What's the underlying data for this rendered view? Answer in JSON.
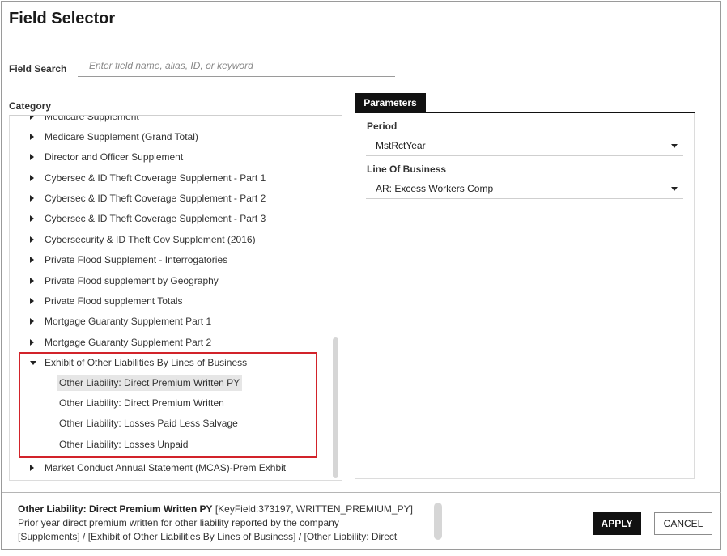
{
  "dialog": {
    "title": "Field Selector"
  },
  "search": {
    "label": "Field Search",
    "placeholder": "Enter field name, alias, ID, or keyword",
    "value": ""
  },
  "category": {
    "label": "Category",
    "items": [
      {
        "label": "Medicare Supplement",
        "expanded": false
      },
      {
        "label": "Medicare Supplement (Grand Total)",
        "expanded": false
      },
      {
        "label": "Director and Officer Supplement",
        "expanded": false
      },
      {
        "label": "Cybersec & ID Theft Coverage Supplement - Part 1",
        "expanded": false
      },
      {
        "label": "Cybersec & ID Theft Coverage Supplement - Part 2",
        "expanded": false
      },
      {
        "label": "Cybersec & ID Theft Coverage Supplement - Part 3",
        "expanded": false
      },
      {
        "label": "Cybersecurity & ID Theft Cov Supplement (2016)",
        "expanded": false
      },
      {
        "label": "Private Flood Supplement - Interrogatories",
        "expanded": false
      },
      {
        "label": "Private Flood supplement by Geography",
        "expanded": false
      },
      {
        "label": "Private Flood supplement Totals",
        "expanded": false
      },
      {
        "label": "Mortgage Guaranty Supplement Part 1",
        "expanded": false
      },
      {
        "label": "Mortgage Guaranty Supplement Part 2",
        "expanded": false
      },
      {
        "label": "Exhibit of Other Liabilities By Lines of Business",
        "expanded": true
      },
      {
        "label": "Market Conduct Annual Statement (MCAS)-Prem Exhbit",
        "expanded": false
      }
    ],
    "children": [
      {
        "label": "Other Liability: Direct Premium Written PY",
        "selected": true
      },
      {
        "label": "Other Liability: Direct Premium Written",
        "selected": false
      },
      {
        "label": "Other Liability: Losses Paid Less Salvage",
        "selected": false
      },
      {
        "label": "Other Liability: Losses Unpaid",
        "selected": false
      }
    ]
  },
  "parameters": {
    "tab_label": "Parameters",
    "period": {
      "label": "Period",
      "value": "MstRctYear"
    },
    "line_of_business": {
      "label": "Line Of Business",
      "value": "AR: Excess Workers Comp"
    }
  },
  "footer": {
    "field_name": "Other Liability: Direct Premium Written PY",
    "field_meta": "[KeyField:373197, WRITTEN_PREMIUM_PY]",
    "description": "Prior year direct premium written for other liability reported by the company",
    "path": "[Supplements] / [Exhibit of Other Liabilities By Lines of Business] / [Other Liability: Direct",
    "apply_label": "APPLY",
    "cancel_label": "CANCEL"
  },
  "colors": {
    "accent": "#111111",
    "highlight_border": "#d2232a",
    "selected_row": "#e6e6e6"
  }
}
